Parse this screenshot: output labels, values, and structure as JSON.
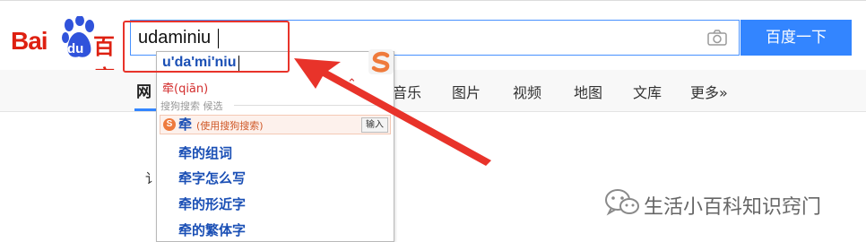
{
  "logo": {
    "latin": "Bai",
    "paw_text": "du",
    "cn": "百度"
  },
  "search": {
    "value": "udaminiu",
    "button_label": "百度一下"
  },
  "nav": {
    "active_char": "网",
    "items": [
      "音乐",
      "图片",
      "视频",
      "地图",
      "文库",
      "更多»"
    ]
  },
  "ime": {
    "composition": "u'da'mi'niu",
    "candidate": "牵(qiān)",
    "toggle": "⌃",
    "section_label": "搜狗搜索  候选",
    "sogou_badge": "S",
    "sogou_char": "牵",
    "sogou_note": "(使用搜狗搜索)",
    "sogou_input": "输入",
    "suggestions": [
      "牵的组词",
      "牵字怎么写",
      "牵的形近字",
      "牵的繁体字"
    ]
  },
  "partial_text": "讠",
  "watermark": {
    "text": "生活小百科知识窍门"
  },
  "colors": {
    "baidu_red": "#de2011",
    "button_blue": "#3385ff",
    "highlight_red": "#e8332a",
    "link_blue": "#1a4fb5"
  },
  "icons": {
    "camera": "camera-icon",
    "sogou": "sogou-logo-icon",
    "wechat": "wechat-icon"
  }
}
